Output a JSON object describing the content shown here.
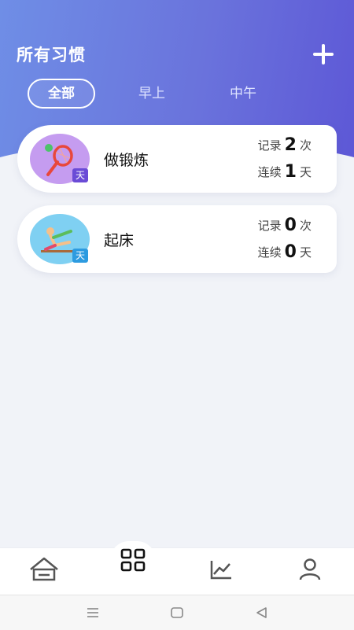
{
  "header": {
    "title": "所有习惯",
    "add_icon": "plus-icon"
  },
  "tabs": [
    {
      "label": "全部",
      "active": true
    },
    {
      "label": "早上",
      "active": false
    },
    {
      "label": "中午",
      "active": false
    }
  ],
  "habits": [
    {
      "name": "做锻炼",
      "icon": "tennis-racket-icon",
      "badge": "天",
      "badge_color": "#6a4bd6",
      "avatar_color": "#c59cf0",
      "record_label": "记录",
      "record_value": "2",
      "record_unit": "次",
      "streak_label": "连续",
      "streak_value": "1",
      "streak_unit": "天"
    },
    {
      "name": "起床",
      "icon": "stretch-person-icon",
      "badge": "天",
      "badge_color": "#2d9be0",
      "avatar_color": "#7fd0f2",
      "record_label": "记录",
      "record_value": "0",
      "record_unit": "次",
      "streak_label": "连续",
      "streak_value": "0",
      "streak_unit": "天"
    }
  ],
  "bottom_nav": [
    "home-icon",
    "grid-icon",
    "chart-icon",
    "profile-icon"
  ],
  "colors": {
    "header_start": "#6f8ee6",
    "header_end": "#5d57d6",
    "background": "#f1f3f8"
  }
}
